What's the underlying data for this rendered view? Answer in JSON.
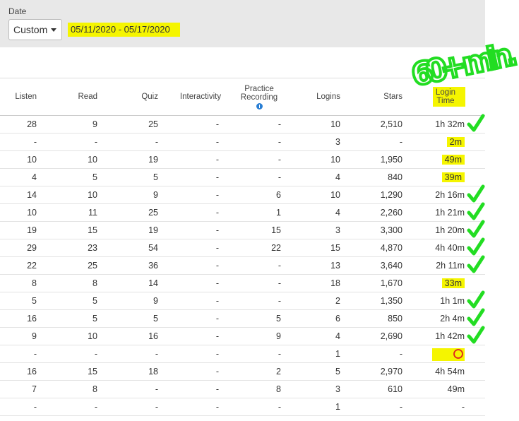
{
  "filter": {
    "date_label": "Date",
    "range_type": "Custom",
    "date_range": "05/11/2020 - 05/17/2020"
  },
  "annotation": {
    "handwritten_note": "60+ min."
  },
  "columns": [
    "Listen",
    "Read",
    "Quiz",
    "Interactivity",
    "Practice Recording",
    "Logins",
    "Stars",
    "Login Time"
  ],
  "header": {
    "listen": "Listen",
    "read": "Read",
    "quiz": "Quiz",
    "interactivity": "Interactivity",
    "practice_line1": "Practice",
    "practice_line2": "Recording",
    "logins": "Logins",
    "stars": "Stars",
    "login_line1": "Login",
    "login_line2": "Time"
  },
  "rows": [
    {
      "listen": "28",
      "read": "9",
      "quiz": "25",
      "interactivity": "-",
      "practice": "-",
      "logins": "10",
      "stars": "2,510",
      "login_time": "1h 32m",
      "mark": "check",
      "highlight": false
    },
    {
      "listen": "-",
      "read": "-",
      "quiz": "-",
      "interactivity": "-",
      "practice": "-",
      "logins": "3",
      "stars": "-",
      "login_time": "2m",
      "mark": "",
      "highlight": true
    },
    {
      "listen": "10",
      "read": "10",
      "quiz": "19",
      "interactivity": "-",
      "practice": "-",
      "logins": "10",
      "stars": "1,950",
      "login_time": "49m",
      "mark": "",
      "highlight": true
    },
    {
      "listen": "4",
      "read": "5",
      "quiz": "5",
      "interactivity": "-",
      "practice": "-",
      "logins": "4",
      "stars": "840",
      "login_time": "39m",
      "mark": "",
      "highlight": true
    },
    {
      "listen": "14",
      "read": "10",
      "quiz": "9",
      "interactivity": "-",
      "practice": "6",
      "logins": "10",
      "stars": "1,290",
      "login_time": "2h 16m",
      "mark": "check",
      "highlight": false
    },
    {
      "listen": "10",
      "read": "11",
      "quiz": "25",
      "interactivity": "-",
      "practice": "1",
      "logins": "4",
      "stars": "2,260",
      "login_time": "1h 21m",
      "mark": "check",
      "highlight": false
    },
    {
      "listen": "19",
      "read": "15",
      "quiz": "19",
      "interactivity": "-",
      "practice": "15",
      "logins": "3",
      "stars": "3,300",
      "login_time": "1h 20m",
      "mark": "check",
      "highlight": false
    },
    {
      "listen": "29",
      "read": "23",
      "quiz": "54",
      "interactivity": "-",
      "practice": "22",
      "logins": "15",
      "stars": "4,870",
      "login_time": "4h 40m",
      "mark": "check",
      "highlight": false
    },
    {
      "listen": "22",
      "read": "25",
      "quiz": "36",
      "interactivity": "-",
      "practice": "-",
      "logins": "13",
      "stars": "3,640",
      "login_time": "2h 11m",
      "mark": "check",
      "highlight": false
    },
    {
      "listen": "8",
      "read": "8",
      "quiz": "14",
      "interactivity": "-",
      "practice": "-",
      "logins": "18",
      "stars": "1,670",
      "login_time": "33m",
      "mark": "",
      "highlight": true
    },
    {
      "listen": "5",
      "read": "5",
      "quiz": "9",
      "interactivity": "-",
      "practice": "-",
      "logins": "2",
      "stars": "1,350",
      "login_time": "1h 1m",
      "mark": "check",
      "highlight": false
    },
    {
      "listen": "16",
      "read": "5",
      "quiz": "5",
      "interactivity": "-",
      "practice": "5",
      "logins": "6",
      "stars": "850",
      "login_time": "2h 4m",
      "mark": "check",
      "highlight": false
    },
    {
      "listen": "9",
      "read": "10",
      "quiz": "16",
      "interactivity": "-",
      "practice": "9",
      "logins": "4",
      "stars": "2,690",
      "login_time": "1h 42m",
      "mark": "check",
      "highlight": false
    },
    {
      "listen": "-",
      "read": "-",
      "quiz": "-",
      "interactivity": "-",
      "practice": "-",
      "logins": "1",
      "stars": "-",
      "login_time": "",
      "mark": "circle",
      "highlight": true
    },
    {
      "listen": "16",
      "read": "15",
      "quiz": "18",
      "interactivity": "-",
      "practice": "2",
      "logins": "5",
      "stars": "2,970",
      "login_time": "4h 54m",
      "mark": "",
      "highlight": false
    },
    {
      "listen": "7",
      "read": "8",
      "quiz": "-",
      "interactivity": "-",
      "practice": "8",
      "logins": "3",
      "stars": "610",
      "login_time": "49m",
      "mark": "",
      "highlight": false
    },
    {
      "listen": "-",
      "read": "-",
      "quiz": "-",
      "interactivity": "-",
      "practice": "-",
      "logins": "1",
      "stars": "-",
      "login_time": "-",
      "mark": "",
      "highlight": false
    }
  ],
  "colors": {
    "highlight": "#f5f500",
    "check_mark": "#22dd22",
    "circle_mark": "#e02020",
    "filter_bg": "#e8e8e8"
  }
}
